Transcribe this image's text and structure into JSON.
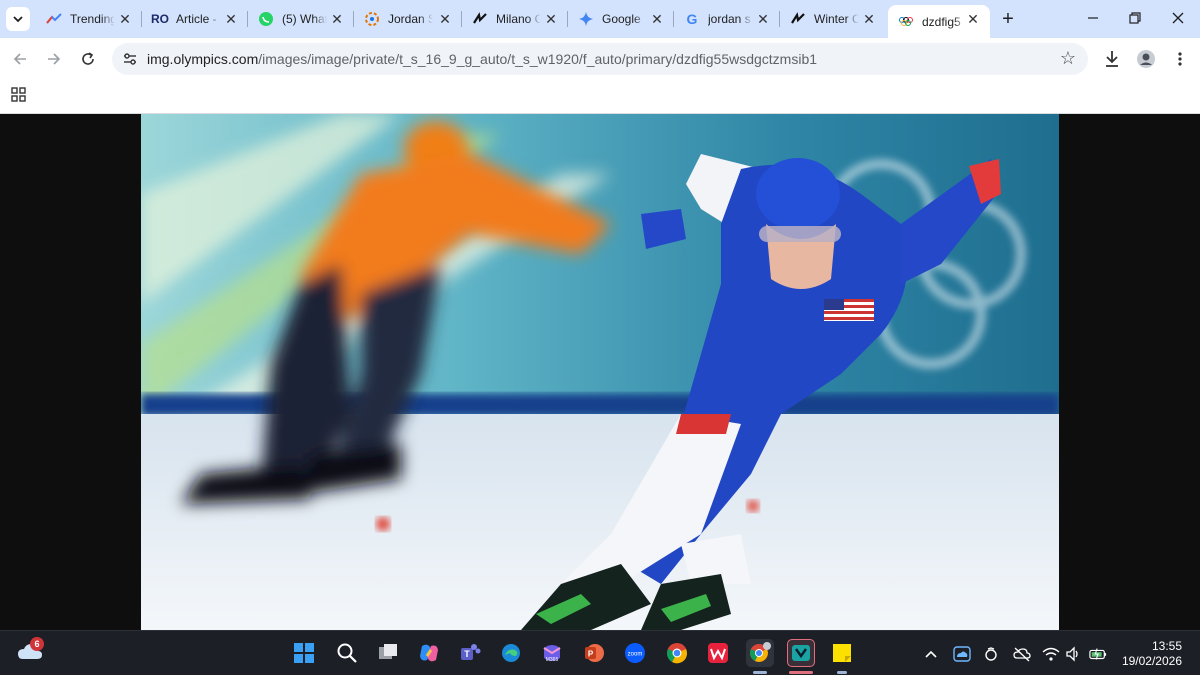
{
  "browser": {
    "tabs": [
      {
        "title": "Trending",
        "icon": "trending-icon"
      },
      {
        "title": "Article -",
        "icon": "ro-icon"
      },
      {
        "title": "(5) What",
        "icon": "whatsapp-icon"
      },
      {
        "title": "Jordan S",
        "icon": "jordan-icon"
      },
      {
        "title": "Milano C",
        "icon": "milano-icon"
      },
      {
        "title": "Google",
        "icon": "gemini-icon"
      },
      {
        "title": "jordan s",
        "icon": "google-icon"
      },
      {
        "title": "Winter C",
        "icon": "winter-icon"
      },
      {
        "title": "dzdfig5",
        "icon": "olympics-icon",
        "active": true
      }
    ],
    "url_host": "img.olympics.com",
    "url_path": "/images/image/private/t_s_16_9_g_auto/t_s_w1920/f_auto/primary/dzdfig55wsdgctzmsib1"
  },
  "taskbar": {
    "weather_badge": "6",
    "time": "13:55",
    "date": "19/02/2026",
    "apps": [
      "windows-start",
      "search",
      "task-view",
      "copilot",
      "teams",
      "edge",
      "m365",
      "powerpoint",
      "zoom",
      "chrome",
      "wps",
      "chrome-profile",
      "app-active",
      "sticky-notes"
    ]
  },
  "colors": {
    "tabstrip": "#d3e3fd",
    "taskbar": "#1c1f26",
    "accent": "#0b57d0"
  }
}
